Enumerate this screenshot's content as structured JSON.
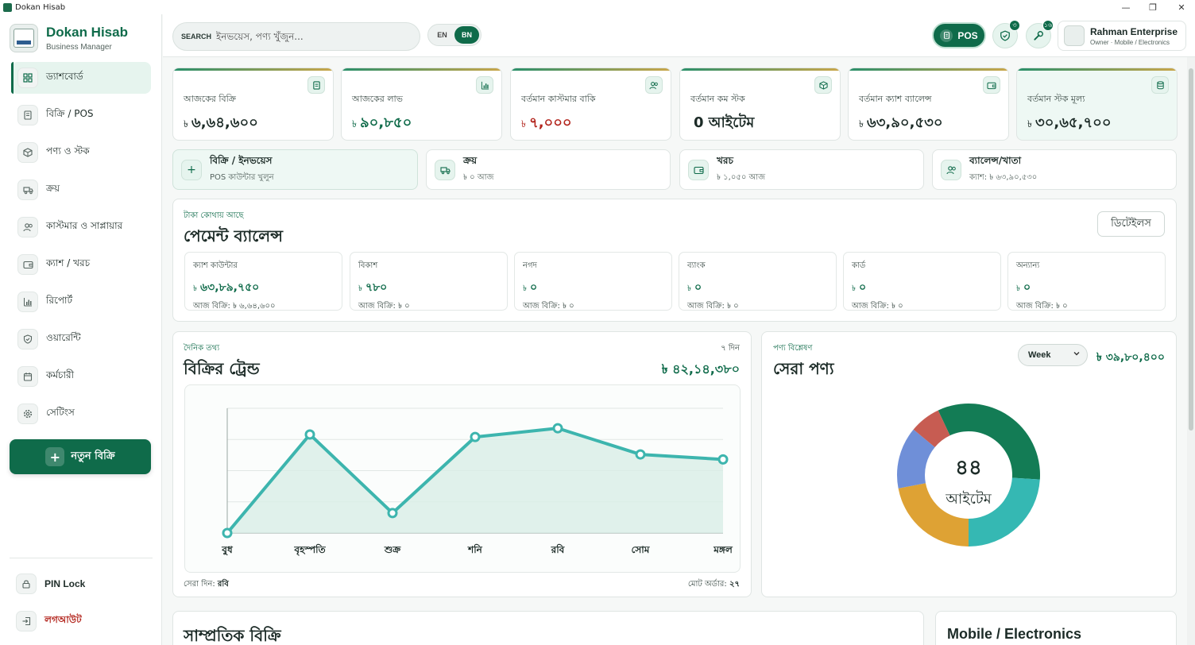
{
  "window": {
    "title": "Dokan Hisab",
    "minimize": "—",
    "maximize": "❐",
    "close": "✕"
  },
  "brand": {
    "name": "Dokan Hisab",
    "subtitle": "Business Manager"
  },
  "nav": [
    {
      "label": "ড্যাশবোর্ড",
      "icon": "grid-icon",
      "active": true
    },
    {
      "label": "বিক্রি / POS",
      "icon": "receipt-icon"
    },
    {
      "label": "পণ্য ও স্টক",
      "icon": "box-icon"
    },
    {
      "label": "ক্রয়",
      "icon": "truck-icon"
    },
    {
      "label": "কাস্টমার ও সাপ্লায়ার",
      "icon": "users-icon"
    },
    {
      "label": "ক্যাশ / খরচ",
      "icon": "wallet-icon"
    },
    {
      "label": "রিপোর্ট",
      "icon": "chart-icon"
    },
    {
      "label": "ওয়ারেন্টি",
      "icon": "shield-icon"
    },
    {
      "label": "কর্মচারী",
      "icon": "calendar-icon"
    },
    {
      "label": "সেটিংস",
      "icon": "gear-icon"
    }
  ],
  "new_sale": "নতুন বিক্রি",
  "pin_lock": "PIN Lock",
  "logout": "লগআউট",
  "search": {
    "label": "SEARCH",
    "placeholder": "ইনভয়েস, পণ্য খুঁজুন..."
  },
  "lang": {
    "en": "EN",
    "bn": "BN",
    "selected": "BN"
  },
  "pos_button": "POS",
  "badges": {
    "warranty": "৩",
    "tools": "১৬"
  },
  "profile": {
    "name": "Rahman Enterprise",
    "role": "Owner · Mobile / Electronics"
  },
  "stats": [
    {
      "label": "আজকের বিক্রি",
      "currency": "৳",
      "value": "৬,৬৪,৬০০",
      "icon": "receipt-icon",
      "color": "#1c2b27"
    },
    {
      "label": "আজকের লাভ",
      "currency": "৳",
      "value": "৯০,৮৫০",
      "icon": "chart-icon",
      "color": "#0f6b4a"
    },
    {
      "label": "বর্তমান কাস্টমার বাকি",
      "currency": "৳",
      "value": "৭,০০০",
      "icon": "users-icon",
      "color": "#b3261e"
    },
    {
      "label": "বর্তমান কম স্টক",
      "currency": "",
      "value": "0 আইটেম",
      "icon": "box-icon",
      "color": "#1c2b27"
    },
    {
      "label": "বর্তমান ক্যাশ ব্যালেন্স",
      "currency": "৳",
      "value": "৬৩,৯০,৫৩০",
      "icon": "wallet-icon",
      "color": "#1c2b27"
    },
    {
      "label": "বর্তমান স্টক মূল্য",
      "currency": "৳",
      "value": "৩০,৬৫,৭০০",
      "icon": "database-icon",
      "color": "#1c2b27"
    }
  ],
  "quick_actions": [
    {
      "title": "বিক্রি / ইনভয়েস",
      "sub": "POS কাউন্টার খুলুন",
      "icon": "plus-icon"
    },
    {
      "title": "ক্রয়",
      "sub": "৳ ০ আজ",
      "icon": "truck-icon"
    },
    {
      "title": "খরচ",
      "sub": "৳ ১,০৫০ আজ",
      "icon": "wallet-icon"
    },
    {
      "title": "ব্যালেন্স/খাতা",
      "sub": "ক্যাশ: ৳ ৬৩,৯০,৫৩০",
      "icon": "users-icon"
    }
  ],
  "payment": {
    "kicker": "টাকা কোথায় আছে",
    "title": "পেমেন্ট ব্যালেন্স",
    "details": "ডিটেইলস",
    "cards": [
      {
        "label": "ক্যাশ কাউন্টার",
        "currency": "৳",
        "value": "৬৩,৮৯,৭৫০",
        "sub": "আজ বিক্রি: ৳ ৬,৬৪,৬০০"
      },
      {
        "label": "বিকাশ",
        "currency": "৳",
        "value": "৭৮০",
        "sub": "আজ বিক্রি: ৳ ০"
      },
      {
        "label": "নগদ",
        "currency": "৳",
        "value": "০",
        "sub": "আজ বিক্রি: ৳ ০"
      },
      {
        "label": "ব্যাংক",
        "currency": "৳",
        "value": "০",
        "sub": "আজ বিক্রি: ৳ ০"
      },
      {
        "label": "কার্ড",
        "currency": "৳",
        "value": "০",
        "sub": "আজ বিক্রি: ৳ ০"
      },
      {
        "label": "অন্যান্য",
        "currency": "৳",
        "value": "০",
        "sub": "আজ বিক্রি: ৳ ০"
      }
    ]
  },
  "trend": {
    "kicker": "দৈনিক তথ্য",
    "title": "বিক্রির ট্রেন্ড",
    "period": "৭ দিন",
    "total": "৳ ৪২,১৪,৩৮০",
    "best_day_label": "সেরা দিন:",
    "best_day": "রবি",
    "orders_label": "মোট অর্ডার:",
    "orders": "২৭"
  },
  "top_products": {
    "kicker": "পণ্য বিশ্লেষণ",
    "title": "সেরা পণ্য",
    "period_options": [
      "Week"
    ],
    "period_selected": "Week",
    "total": "৳ ৩৯,৮০,৪০০",
    "center_value": "৪৪",
    "center_label": "আইটেম"
  },
  "recent_sales": {
    "title": "সাম্প্রতিক বিক্রি"
  },
  "business_type": {
    "title": "Mobile / Electronics"
  },
  "chart_data": [
    {
      "type": "area",
      "categories": [
        "বুধ",
        "বৃহস্পতি",
        "শুক্র",
        "শনি",
        "রবি",
        "সোম",
        "মঙ্গল"
      ],
      "values": [
        0,
        0.79,
        0.16,
        0.77,
        0.84,
        0.63,
        0.59
      ],
      "ylim": [
        0,
        1
      ],
      "grid": true,
      "color": "#3db5ae"
    },
    {
      "type": "pie",
      "slices": [
        {
          "value": 33,
          "color": "#137c55"
        },
        {
          "value": 24,
          "color": "#35b8b3"
        },
        {
          "value": 22,
          "color": "#dea234"
        },
        {
          "value": 14,
          "color": "#6f8fd8"
        },
        {
          "value": 7,
          "color": "#c75c52"
        }
      ]
    }
  ]
}
